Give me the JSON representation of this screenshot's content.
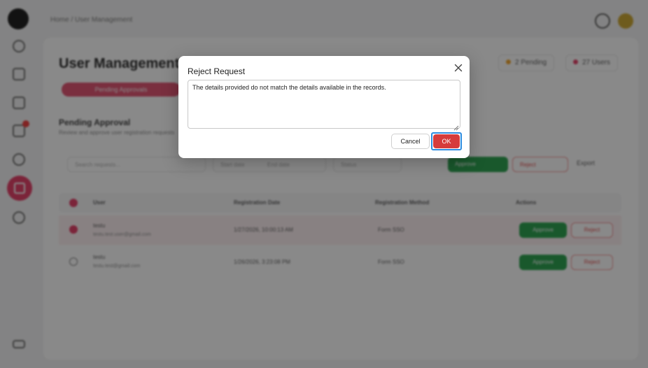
{
  "breadcrumb": {
    "home": "Home",
    "separator": "/",
    "current": "User Management"
  },
  "page": {
    "title": "User Management",
    "chips": [
      {
        "label": "2 Pending",
        "color": "#f0a020"
      },
      {
        "label": "27 Users",
        "color": "#e3345f"
      }
    ],
    "active_tab": "Pending Approvals",
    "section_title": "Pending Approval",
    "section_subtitle": "Review and approve user registration requests"
  },
  "filters": {
    "search_placeholder": "Search requests...",
    "start_date": "Start date",
    "end_date": "End date",
    "status": "Status",
    "approve_label": "Approve",
    "reject_label": "Reject",
    "export_label": "Export"
  },
  "table": {
    "columns": [
      "User",
      "Registration Date",
      "Registration Method",
      "Actions"
    ],
    "rows": [
      {
        "name": "testu",
        "email": "testu.test.user@gmail.com",
        "date": "1/27/2026, 10:00:13 AM",
        "method": "Form SSO",
        "approve": "Approve",
        "reject": "Reject"
      },
      {
        "name": "testu",
        "email": "testu.test@gmail.com",
        "date": "1/26/2026, 3:23:08 PM",
        "method": "Form SSO",
        "approve": "Approve",
        "reject": "Reject"
      }
    ]
  },
  "modal": {
    "title": "Reject Request",
    "reason_text": "The details provided do not match the details available in the records.",
    "cancel_label": "Cancel",
    "ok_label": "OK",
    "ok_color": "#d63b3b",
    "focus_ring_color": "#2d8ce0"
  }
}
